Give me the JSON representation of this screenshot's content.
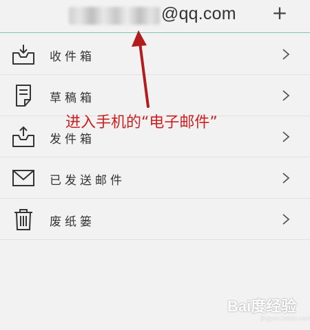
{
  "header": {
    "account_domain": "@qq.com",
    "add_icon": "plus-icon",
    "accent_line_color": "#7fc4a6"
  },
  "folders": [
    {
      "label": "收件箱",
      "icon": "inbox-icon"
    },
    {
      "label": "草稿箱",
      "icon": "drafts-icon"
    },
    {
      "label": "发件箱",
      "icon": "outbox-icon"
    },
    {
      "label": "已发送邮件",
      "icon": "sent-mail-icon"
    },
    {
      "label": "废纸篓",
      "icon": "trash-icon"
    }
  ],
  "annotation": {
    "text": "进入手机的“电子邮件”",
    "color": "#cc1f1f"
  },
  "watermark": {
    "text": "Bai度经验",
    "sub": "jingyan.baidu.com"
  }
}
